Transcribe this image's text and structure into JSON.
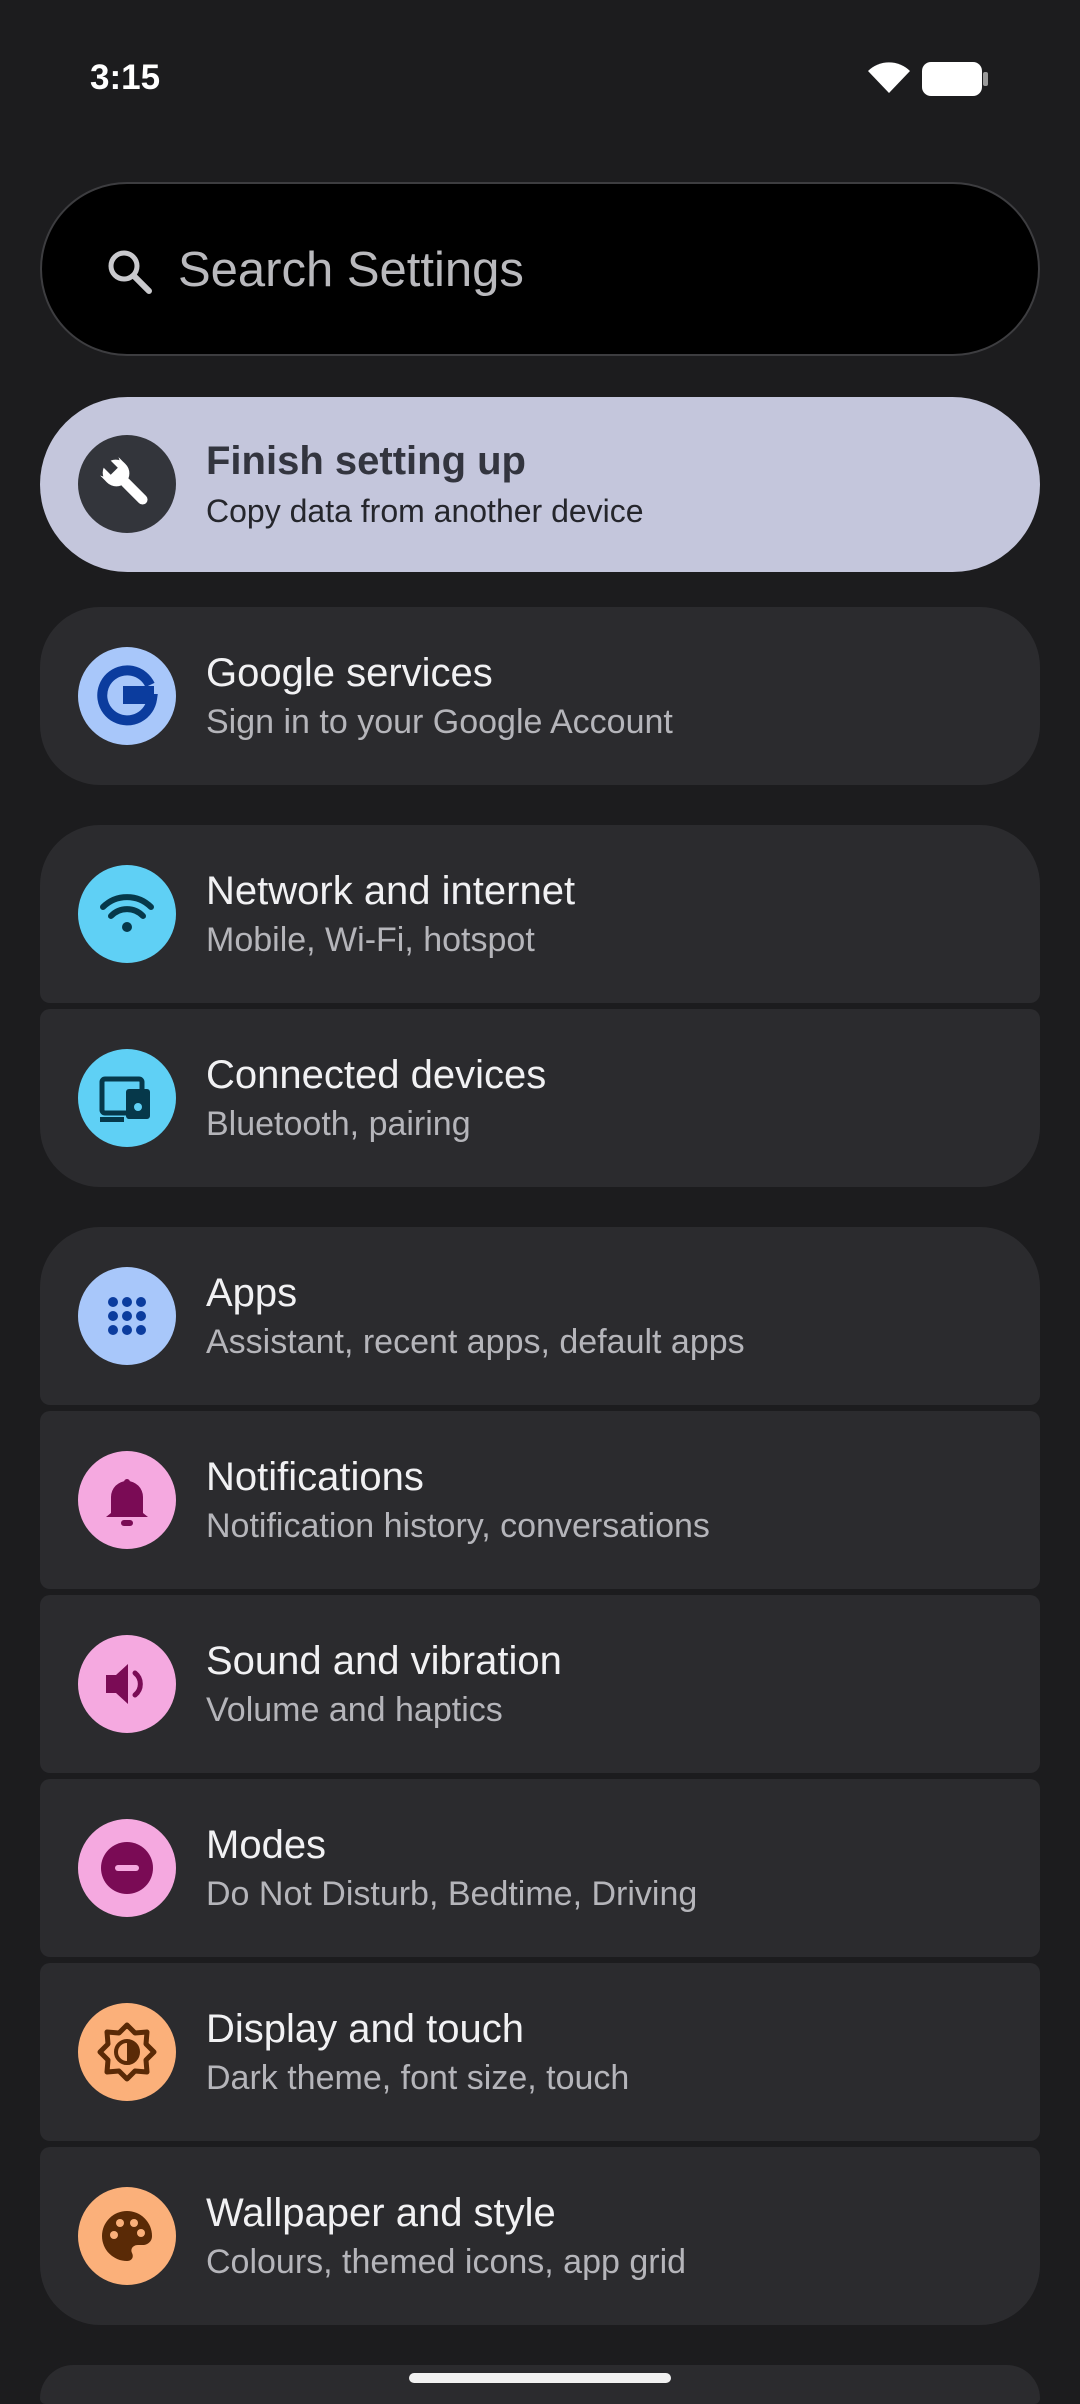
{
  "status_bar": {
    "time": "3:15",
    "wifi_icon": "wifi-icon",
    "battery_icon": "battery-icon"
  },
  "search": {
    "placeholder": "Search Settings",
    "icon": "search-icon"
  },
  "setup": {
    "title": "Finish setting up",
    "subtitle": "Copy data from another device",
    "icon": "wrench-icon"
  },
  "items": [
    {
      "id": "google",
      "title": "Google services",
      "subtitle": "Sign in to your Google Account",
      "icon": "google-icon",
      "color": "#a8c7fa",
      "glyph_color": "#0b3c9e"
    },
    {
      "id": "network",
      "title": "Network and internet",
      "subtitle": "Mobile, Wi-Fi, hotspot",
      "icon": "wifi-icon",
      "color": "#5fd0f5",
      "glyph_color": "#06384a"
    },
    {
      "id": "connected",
      "title": "Connected devices",
      "subtitle": "Bluetooth, pairing",
      "icon": "devices-icon",
      "color": "#5fd0f5",
      "glyph_color": "#06384a"
    },
    {
      "id": "apps",
      "title": "Apps",
      "subtitle": "Assistant, recent apps, default apps",
      "icon": "apps-grid-icon",
      "color": "#a8c7fa",
      "glyph_color": "#0b3c9e"
    },
    {
      "id": "notifications",
      "title": "Notifications",
      "subtitle": "Notification history, conversations",
      "icon": "bell-icon",
      "color": "#f5a9e0",
      "glyph_color": "#7a0b55"
    },
    {
      "id": "sound",
      "title": "Sound and vibration",
      "subtitle": "Volume and haptics",
      "icon": "speaker-icon",
      "color": "#f5a9e0",
      "glyph_color": "#7a0b55"
    },
    {
      "id": "modes",
      "title": "Modes",
      "subtitle": "Do Not Disturb, Bedtime, Driving",
      "icon": "do-not-disturb-icon",
      "color": "#f5a9e0",
      "glyph_color": "#7a0b55"
    },
    {
      "id": "display",
      "title": "Display and touch",
      "subtitle": "Dark theme, font size, touch",
      "icon": "brightness-icon",
      "color": "#fbb07a",
      "glyph_color": "#5a2a06"
    },
    {
      "id": "wallpaper",
      "title": "Wallpaper and style",
      "subtitle": "Colours, themed icons, app grid",
      "icon": "palette-icon",
      "color": "#fbb07a",
      "glyph_color": "#5a2a06"
    }
  ]
}
